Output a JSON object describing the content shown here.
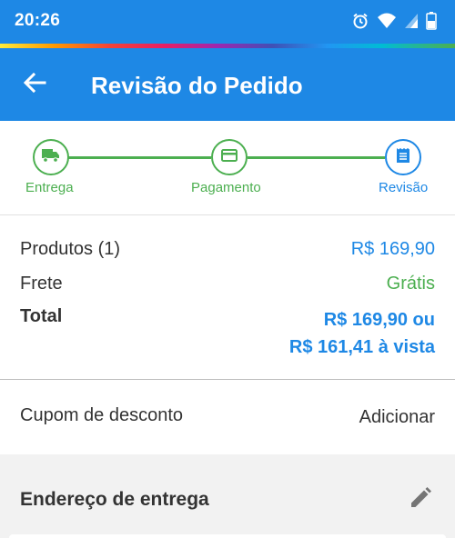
{
  "status_bar": {
    "time": "20:26",
    "icons": [
      "alarm-icon",
      "wifi-icon",
      "signal-icon",
      "battery-icon"
    ]
  },
  "app_bar": {
    "back_icon": "arrow-back-icon",
    "title": "Revisão do Pedido"
  },
  "stepper": {
    "steps": [
      {
        "label": "Entrega",
        "icon": "truck-icon",
        "state": "done"
      },
      {
        "label": "Pagamento",
        "icon": "card-icon",
        "state": "done"
      },
      {
        "label": "Revisão",
        "icon": "receipt-icon",
        "state": "active"
      }
    ]
  },
  "summary": {
    "products_label": "Produtos (1)",
    "products_value": "R$ 169,90",
    "shipping_label": "Frete",
    "shipping_value": "Grátis",
    "total_label": "Total",
    "total_value_line1": "R$ 169,90 ou",
    "total_value_line2": "R$ 161,41 à vista"
  },
  "coupon": {
    "label": "Cupom de desconto",
    "action": "Adicionar"
  },
  "address": {
    "title": "Endereço de entrega",
    "edit_icon": "pencil-icon"
  },
  "colors": {
    "primary": "#1e88e5",
    "success": "#4caf50",
    "text": "#333333",
    "section_bg": "#f2f2f2"
  }
}
